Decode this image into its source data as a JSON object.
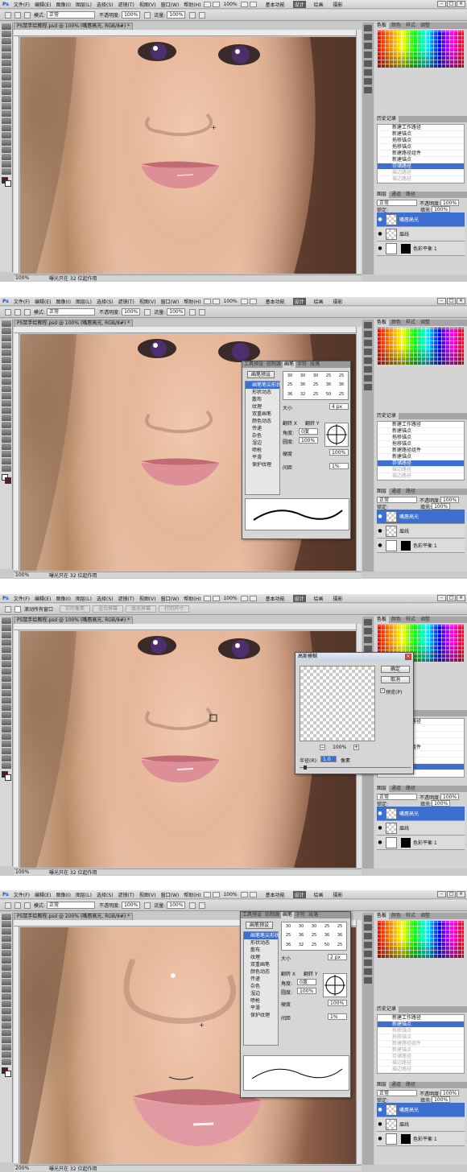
{
  "menu": [
    "文件(F)",
    "编辑(E)",
    "图像(I)",
    "图层(L)",
    "选择(S)",
    "滤镜(T)",
    "视图(V)",
    "窗口(W)",
    "帮助(H)"
  ],
  "zoom_menu": "100%",
  "workspaces": {
    "basic": "基本功能",
    "design": "设计",
    "painting": "绘画",
    "photography": "摄影"
  },
  "brush_options": {
    "mode_label": "模式:",
    "mode_value": "正常",
    "opacity_label": "不透明度:",
    "opacity_value": "100%",
    "flow_label": "流量:",
    "flow_value": "100%"
  },
  "zoom_options": {
    "scroll_all": "滚动所有窗口",
    "actual_pixels": "实际像素",
    "fit_screen": "适合屏幕",
    "fill_screen": "填充屏幕",
    "print_size": "打印尺寸"
  },
  "doc": {
    "tab_100": "PS鼠手绘教程.psd @ 100% (嘴唇高光, RGB/8#) *",
    "tab_200": "PS鼠手绘教程.psd @ 200% (嘴唇高光, RGB/8#) *"
  },
  "status": {
    "zoom_100": "100%",
    "zoom_200": "200%",
    "info": "曝光只在 32 位起作用"
  },
  "panels": {
    "color_tabs": [
      "色板",
      "颜色",
      "样式",
      "调整"
    ],
    "history_title": "历史记录",
    "history_items": [
      "新建工作路径",
      "新建锚点",
      "拖移锚点",
      "拖移锚点",
      "新建路径组件",
      "新建锚点",
      "存储路径",
      "描边路径",
      "描边路径"
    ],
    "layers_tabs": [
      "图层",
      "通道",
      "路径"
    ],
    "blend_mode": "正常",
    "opacity_label": "不透明度:",
    "opacity_value": "100%",
    "lock_label": "锁定:",
    "fill_label": "填充:",
    "fill_value": "100%",
    "layers": [
      "嘴唇高光",
      "眉线",
      "色彩平衡 1"
    ]
  },
  "brush_panel": {
    "tabs": [
      "工具预设",
      "仿制源",
      "画笔",
      "字符",
      "段落"
    ],
    "presets_button": "画笔预设",
    "options": [
      "画笔笔尖形状",
      "形状动态",
      "散布",
      "纹理",
      "双重画笔",
      "颜色动态",
      "传递",
      "杂色",
      "湿边",
      "喷枪",
      "平滑",
      "保护纹理"
    ],
    "tip_sizes": [
      "30",
      "30",
      "30",
      "25",
      "25",
      "25",
      "36",
      "25",
      "36",
      "36",
      "36",
      "32",
      "25",
      "50",
      "25"
    ],
    "size_label": "大小",
    "size_value_1": "4 px",
    "size_value_2": "2 px",
    "flip_x": "翻转 X",
    "flip_y": "翻转 Y",
    "angle_label": "角度:",
    "angle_value": "0度",
    "roundness_label": "圆度:",
    "roundness_value": "100%",
    "hardness_label": "硬度",
    "hardness_value": "100%",
    "spacing_label": "间距",
    "spacing_value": "1%"
  },
  "gauss_dialog": {
    "title": "高斯模糊",
    "ok": "确定",
    "cancel": "取消",
    "preview": "预览(P)",
    "zoom": "100%",
    "radius_label": "半径(R):",
    "radius_value": "1.0",
    "radius_unit": "像素"
  }
}
